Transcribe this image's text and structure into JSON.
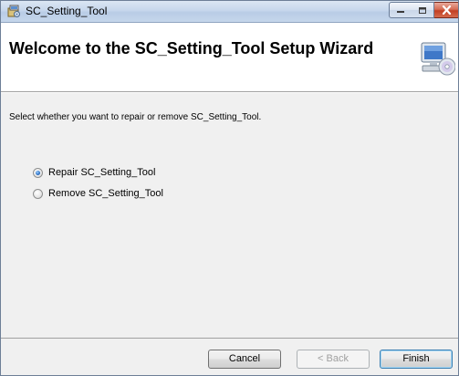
{
  "window": {
    "title": "SC_Setting_Tool",
    "controls": {
      "minimize": "minimize-icon",
      "maximize": "maximize-icon",
      "close": "close-icon"
    }
  },
  "header": {
    "title": "Welcome to the SC_Setting_Tool Setup Wizard",
    "icon": "computer-cd-icon"
  },
  "body": {
    "instruction": "Select whether you want to repair or remove SC_Setting_Tool.",
    "options": [
      {
        "label": "Repair SC_Setting_Tool",
        "selected": true
      },
      {
        "label": "Remove SC_Setting_Tool",
        "selected": false
      }
    ]
  },
  "footer": {
    "cancel_label": "Cancel",
    "back_label": "< Back",
    "finish_label": "Finish"
  }
}
